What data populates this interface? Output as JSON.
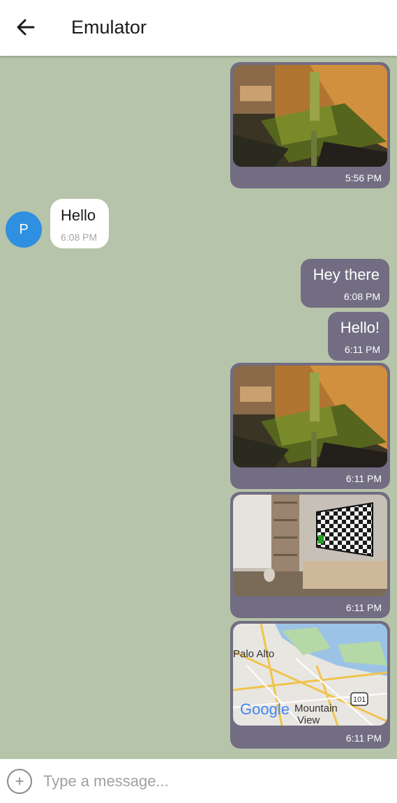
{
  "header": {
    "title": "Emulator"
  },
  "messages": {
    "m1": {
      "time": "5:56 PM"
    },
    "m2": {
      "sender_initial": "P",
      "text": "Hello",
      "time": "6:08 PM"
    },
    "m3": {
      "text": "Hey there",
      "time": "6:08 PM"
    },
    "m4": {
      "text": "Hello!",
      "time": "6:11 PM"
    },
    "m5": {
      "time": "6:11 PM"
    },
    "m6": {
      "time": "6:11 PM"
    },
    "m7": {
      "time": "6:11 PM",
      "map_labels": {
        "city1": "Palo Alto",
        "city2a": "Mountain",
        "city2b": "View",
        "highway": "101",
        "brand": "Google"
      }
    }
  },
  "composer": {
    "placeholder": "Type a message..."
  },
  "colors": {
    "chat_bg": "#b6c4aa",
    "outgoing_bubble": "#726d82",
    "avatar": "#2f8fe0"
  },
  "icons": {
    "back": "arrow-left-icon",
    "add": "plus-circle-icon"
  }
}
